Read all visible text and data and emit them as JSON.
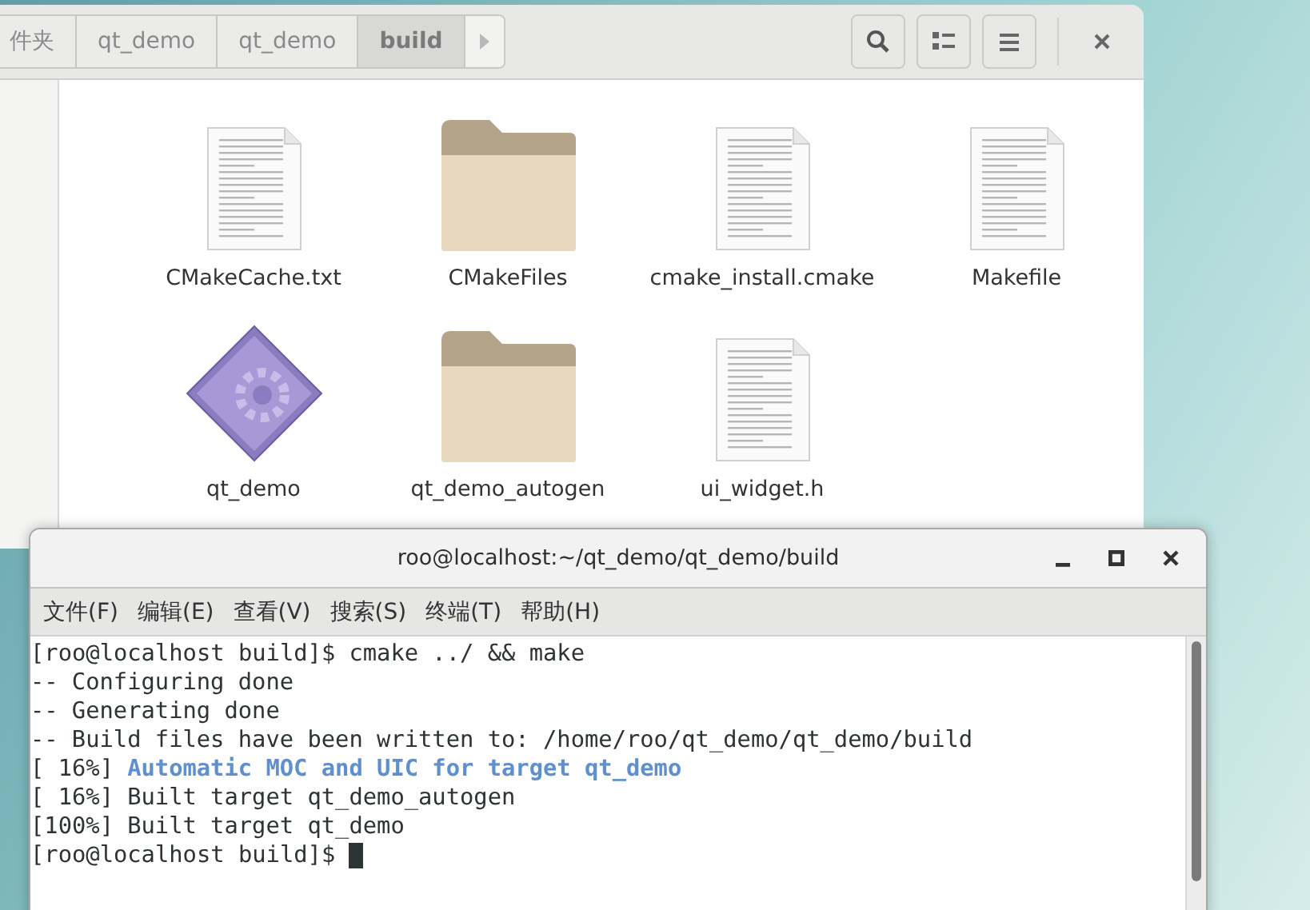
{
  "file_manager": {
    "breadcrumbs": [
      {
        "label": "件夹",
        "selected": false
      },
      {
        "label": "qt_demo",
        "selected": false
      },
      {
        "label": "qt_demo",
        "selected": false
      },
      {
        "label": "build",
        "selected": true
      }
    ],
    "files": [
      {
        "name": "CMakeCache.txt",
        "kind": "text"
      },
      {
        "name": "CMakeFiles",
        "kind": "folder"
      },
      {
        "name": "cmake_install.cmake",
        "kind": "text"
      },
      {
        "name": "Makefile",
        "kind": "text"
      },
      {
        "name": "qt_demo",
        "kind": "project"
      },
      {
        "name": "qt_demo_autogen",
        "kind": "folder"
      },
      {
        "name": "ui_widget.h",
        "kind": "text"
      }
    ]
  },
  "terminal": {
    "title": "roo@localhost:~/qt_demo/qt_demo/build",
    "menu": [
      "文件(F)",
      "编辑(E)",
      "查看(V)",
      "搜索(S)",
      "终端(T)",
      "帮助(H)"
    ],
    "lines": [
      {
        "prefix": "[roo@localhost build]$",
        "text": "cmake ../ && make",
        "highlight": false
      },
      {
        "prefix": "--",
        "text": "Configuring done",
        "highlight": false
      },
      {
        "prefix": "--",
        "text": "Generating done",
        "highlight": false
      },
      {
        "prefix": "--",
        "text": "Build files have been written to: /home/roo/qt_demo/qt_demo/build",
        "highlight": false
      },
      {
        "prefix": "[ 16%]",
        "text": "Automatic MOC and UIC for target qt_demo",
        "highlight": true
      },
      {
        "prefix": "[ 16%]",
        "text": "Built target qt_demo_autogen",
        "highlight": false
      },
      {
        "prefix": "[100%]",
        "text": "Built target qt_demo",
        "highlight": false
      }
    ],
    "prompt": {
      "prefix": "[roo@localhost build]$",
      "cursor": true
    }
  }
}
